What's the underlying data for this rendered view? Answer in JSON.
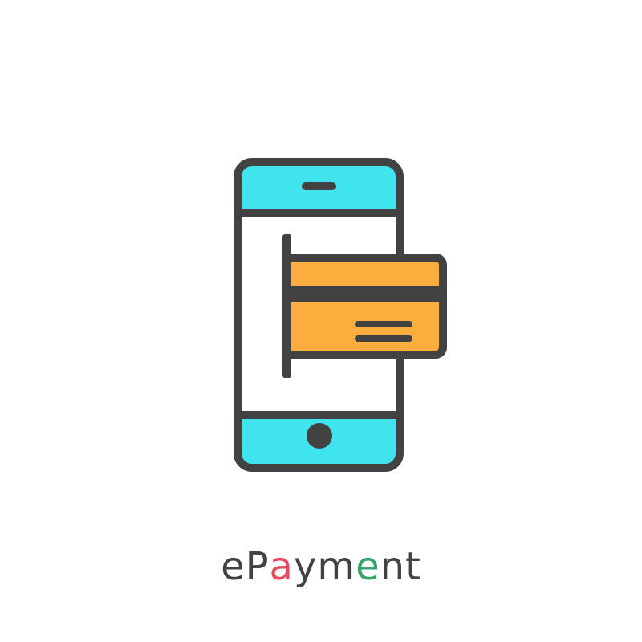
{
  "caption": {
    "text": "ePayment",
    "letters": [
      {
        "char": "e",
        "color": "#424242"
      },
      {
        "char": "P",
        "color": "#424242"
      },
      {
        "char": "a",
        "color": "#e64b5a"
      },
      {
        "char": "y",
        "color": "#424242"
      },
      {
        "char": "m",
        "color": "#424242"
      },
      {
        "char": "e",
        "color": "#3aa36b"
      },
      {
        "char": "n",
        "color": "#424242"
      },
      {
        "char": "t",
        "color": "#424242"
      }
    ]
  },
  "colors": {
    "outline": "#424242",
    "phone_bars": "#3fe4ec",
    "phone_screen": "#ffffff",
    "card": "#fbad3d",
    "background": "#ffffff"
  },
  "icons": {
    "phone": "smartphone-icon",
    "card": "credit-card-icon"
  }
}
